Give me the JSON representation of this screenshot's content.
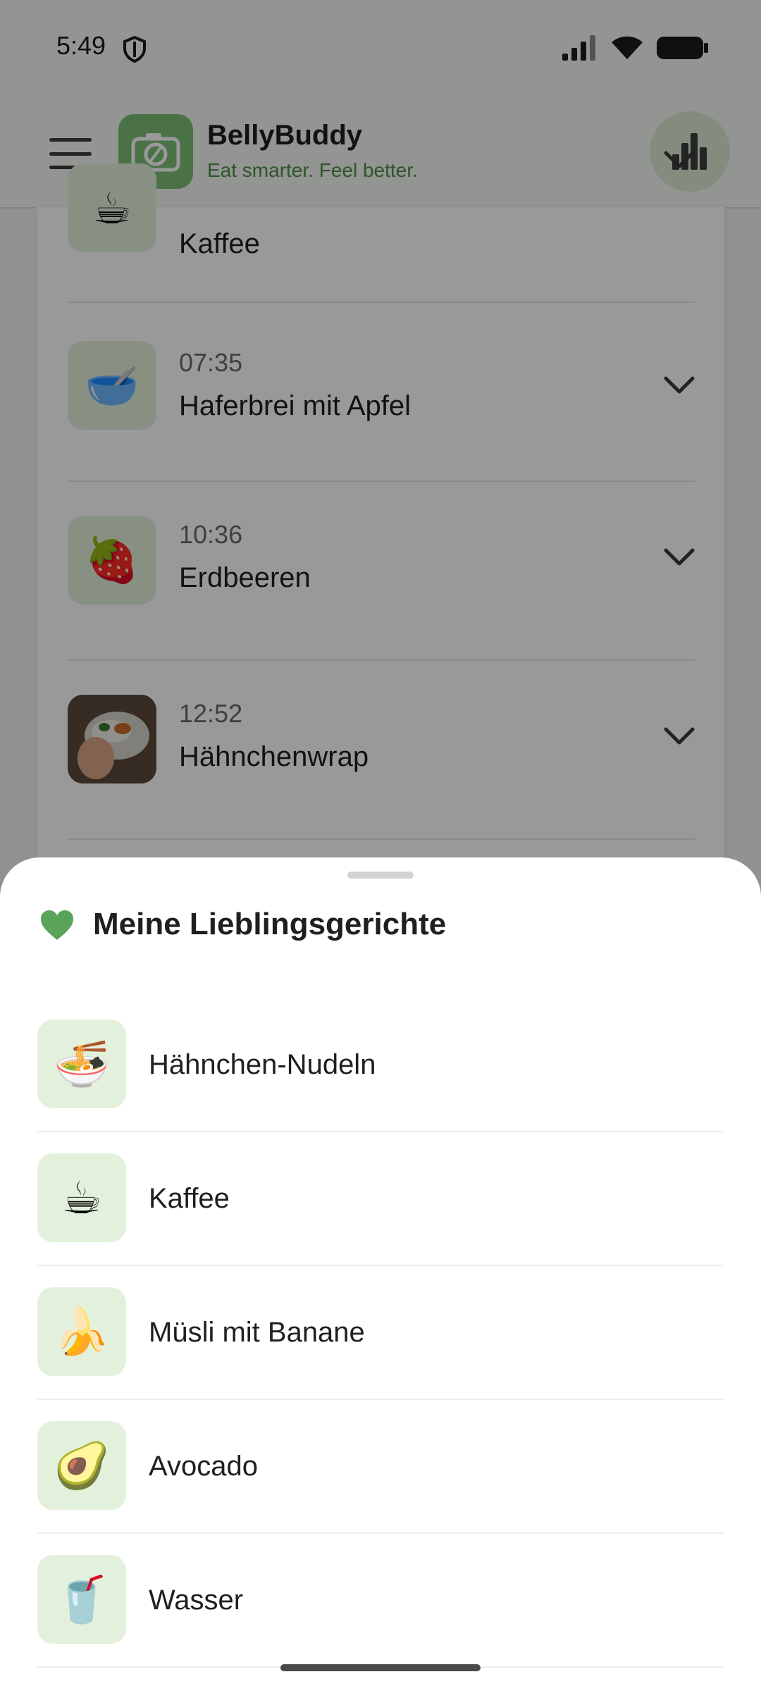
{
  "status_bar": {
    "time": "5:49",
    "shield_icon": "shield-icon",
    "signal_icon": "signal-icon",
    "wifi_icon": "wifi-icon",
    "battery_icon": "battery-icon"
  },
  "app_bar": {
    "menu_icon": "hamburger-menu-icon",
    "logo_icon": "camera-fork-logo",
    "title": "BellyBuddy",
    "tagline": "Eat smarter. Feel better.",
    "stats_icon": "bar-chart-icon"
  },
  "meals": [
    {
      "time": "",
      "name": "Kaffee",
      "icon": "☕",
      "icon_name": "coffee-icon"
    },
    {
      "time": "07:35",
      "name": "Haferbrei mit Apfel",
      "icon": "🥣",
      "icon_name": "bowl-icon"
    },
    {
      "time": "10:36",
      "name": "Erdbeeren",
      "icon": "🍓",
      "icon_name": "strawberry-icon"
    },
    {
      "time": "12:52",
      "name": "Hähnchenwrap",
      "icon": "photo",
      "icon_name": "wrap-photo"
    }
  ],
  "favorites_sheet": {
    "heart_icon": "heart-icon",
    "title": "Meine Lieblingsgerichte",
    "items": [
      {
        "name": "Hähnchen-Nudeln",
        "icon": "🍜",
        "icon_name": "noodles-icon"
      },
      {
        "name": "Kaffee",
        "icon": "☕",
        "icon_name": "coffee-icon"
      },
      {
        "name": "Müsli mit Banane",
        "icon": "🍌",
        "icon_name": "banana-icon"
      },
      {
        "name": "Avocado",
        "icon": "🥑",
        "icon_name": "avocado-icon"
      },
      {
        "name": "Wasser",
        "icon": "🥤",
        "icon_name": "water-cup-icon"
      }
    ]
  },
  "colors": {
    "brand_green": "#7dbe77",
    "tagline_green": "#4e8f47",
    "icon_tile_bg": "#e3f1dc",
    "heart_green": "#5aa35a"
  }
}
